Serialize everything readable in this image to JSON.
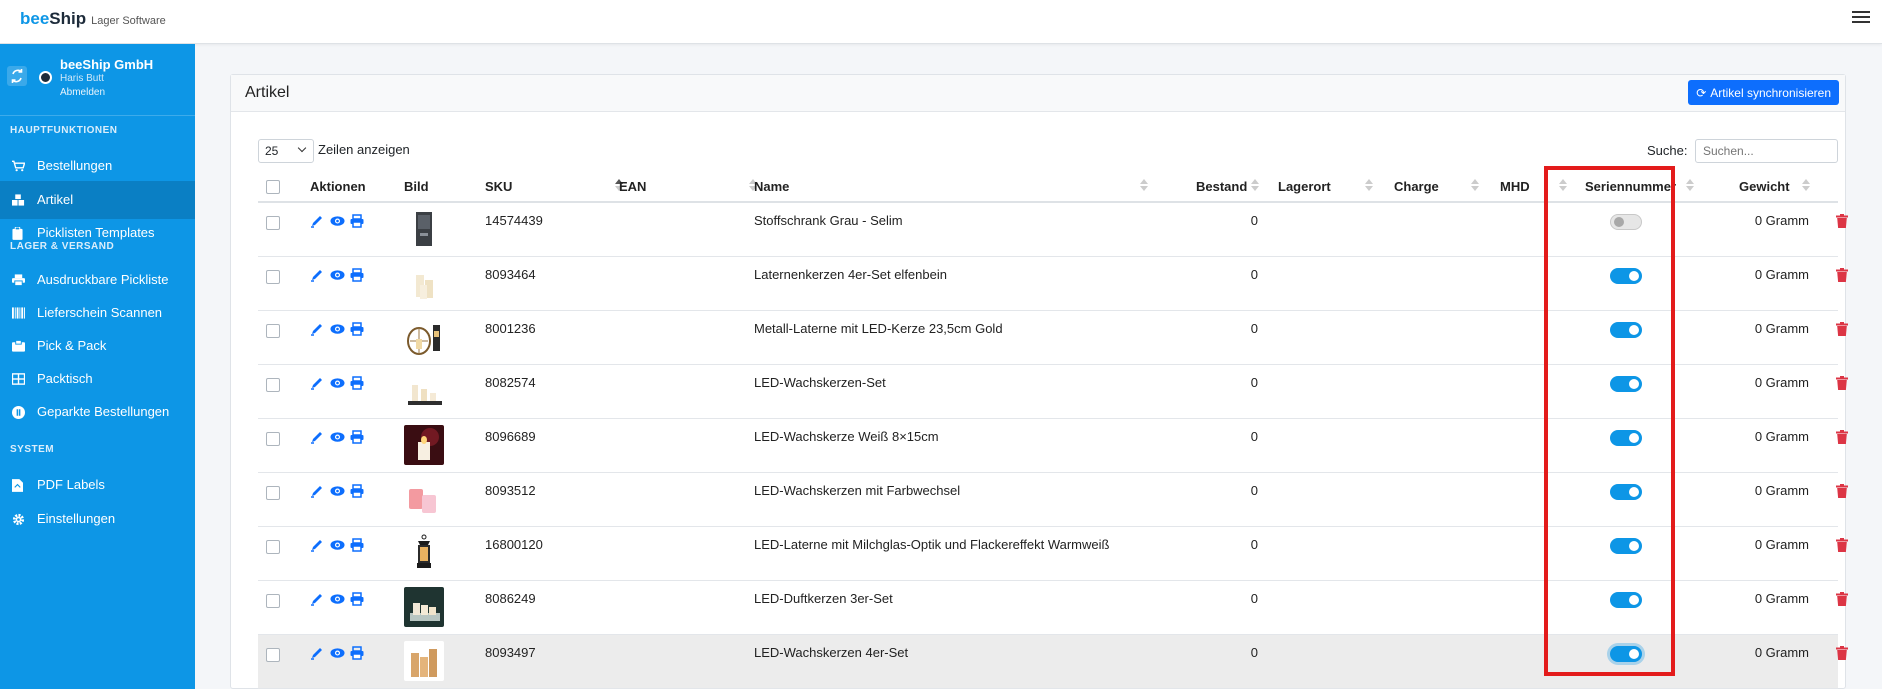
{
  "topbar": {
    "brand_bee": "bee",
    "brand_ship": "Ship",
    "brand_sub": "Lager Software"
  },
  "sidebar": {
    "company": "beeShip GmbH",
    "user": "Haris Butt",
    "logout": "Abmelden",
    "sections": [
      {
        "title": "HAUPTFUNKTIONEN",
        "items": [
          {
            "label": "Bestellungen",
            "icon": "cart-icon",
            "active": false
          },
          {
            "label": "Artikel",
            "icon": "cubes-icon",
            "active": true
          },
          {
            "label": "Picklisten Templates",
            "icon": "clipboard-icon",
            "active": false
          }
        ]
      },
      {
        "title": "LAGER & VERSAND",
        "items": [
          {
            "label": "Ausdruckbare Pickliste",
            "icon": "print-icon",
            "active": false
          },
          {
            "label": "Lieferschein Scannen",
            "icon": "barcode-icon",
            "active": false
          },
          {
            "label": "Pick & Pack",
            "icon": "box-icon",
            "active": false
          },
          {
            "label": "Packtisch",
            "icon": "table-icon",
            "active": false
          },
          {
            "label": "Geparkte Bestellungen",
            "icon": "parking-icon",
            "active": false
          }
        ]
      },
      {
        "title": "SYSTEM",
        "items": [
          {
            "label": "PDF Labels",
            "icon": "pdf-icon",
            "active": false
          },
          {
            "label": "Einstellungen",
            "icon": "gear-icon",
            "active": false
          }
        ]
      }
    ]
  },
  "card": {
    "title": "Artikel",
    "sync_button": "Artikel synchronisieren",
    "length_value": "25",
    "length_label": "Zeilen anzeigen",
    "search_label": "Suche:",
    "search_placeholder": "Suchen..."
  },
  "table": {
    "headers": {
      "actions": "Aktionen",
      "image": "Bild",
      "sku": "SKU",
      "ean": "EAN",
      "name": "Name",
      "stock": "Bestand",
      "location": "Lagerort",
      "batch": "Charge",
      "mhd": "MHD",
      "serial": "Seriennummer",
      "weight": "Gewicht"
    },
    "rows": [
      {
        "sku": "14574439",
        "ean": "",
        "name": "Stoffschrank Grau - Selim",
        "stock": "0",
        "location": "",
        "batch": "",
        "mhd": "",
        "serial": false,
        "weight": "0 Gramm",
        "thumb": "cabinet"
      },
      {
        "sku": "8093464",
        "ean": "",
        "name": "Laternenkerzen 4er-Set elfenbein",
        "stock": "0",
        "location": "",
        "batch": "",
        "mhd": "",
        "serial": true,
        "weight": "0 Gramm",
        "thumb": "candles-ivory"
      },
      {
        "sku": "8001236",
        "ean": "",
        "name": "Metall-Laterne mit LED-Kerze 23,5cm Gold",
        "stock": "0",
        "location": "",
        "batch": "",
        "mhd": "",
        "serial": true,
        "weight": "0 Gramm",
        "thumb": "lantern-gold"
      },
      {
        "sku": "8082574",
        "ean": "",
        "name": "LED-Wachskerzen-Set",
        "stock": "0",
        "location": "",
        "batch": "",
        "mhd": "",
        "serial": true,
        "weight": "0 Gramm",
        "thumb": "candle-set"
      },
      {
        "sku": "8096689",
        "ean": "",
        "name": "LED-Wachskerze Weiß 8×15cm",
        "stock": "0",
        "location": "",
        "batch": "",
        "mhd": "",
        "serial": true,
        "weight": "0 Gramm",
        "thumb": "candle-red"
      },
      {
        "sku": "8093512",
        "ean": "",
        "name": "LED-Wachskerzen mit Farbwechsel",
        "stock": "0",
        "location": "",
        "batch": "",
        "mhd": "",
        "serial": true,
        "weight": "0 Gramm",
        "thumb": "candles-pink"
      },
      {
        "sku": "16800120",
        "ean": "",
        "name": "LED-Laterne mit Milchglas-Optik und Flackereffekt Warmweiß",
        "stock": "0",
        "location": "",
        "batch": "",
        "mhd": "",
        "serial": true,
        "weight": "0 Gramm",
        "thumb": "lantern-black"
      },
      {
        "sku": "8086249",
        "ean": "",
        "name": "LED-Duftkerzen 3er-Set",
        "stock": "0",
        "location": "",
        "batch": "",
        "mhd": "",
        "serial": true,
        "weight": "0 Gramm",
        "thumb": "candles-dark"
      },
      {
        "sku": "8093497",
        "ean": "",
        "name": "LED-Wachskerzen 4er-Set",
        "stock": "0",
        "location": "",
        "batch": "",
        "mhd": "",
        "serial": true,
        "weight": "0 Gramm",
        "thumb": "candles-amber",
        "highlighted": true
      }
    ]
  },
  "colors": {
    "primary": "#0d96e6",
    "sidebar_active": "#0a7fc4",
    "button": "#0d6efd",
    "danger": "#dc3545",
    "highlight_box": "#e31b1b"
  }
}
